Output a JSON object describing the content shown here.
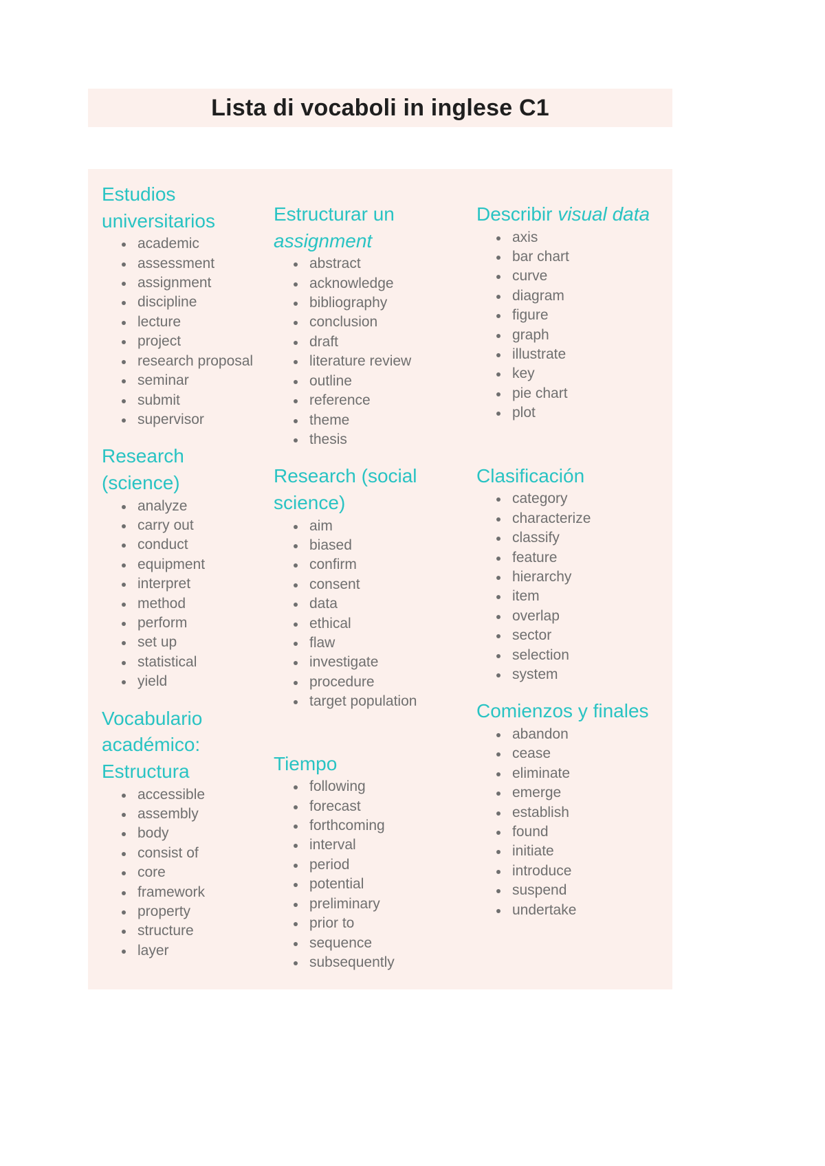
{
  "document": {
    "title": "Lista di vocaboli in inglese C1",
    "accent_color": "#29c3c3",
    "band_color": "#fcf0ec",
    "text_color": "#6f6f6f",
    "title_color": "#1f1f1f"
  },
  "columns": [
    {
      "id": "column-1",
      "sections": [
        {
          "heading_parts": [
            {
              "text": "Estudios universitarios",
              "italic": false
            }
          ],
          "heading_plain": "Estudios universitarios",
          "items": [
            "academic",
            "assessment",
            "assignment",
            "discipline",
            "lecture",
            "project",
            "research proposal",
            "seminar",
            "submit",
            "supervisor"
          ]
        },
        {
          "heading_parts": [
            {
              "text": "Research (science)",
              "italic": false
            }
          ],
          "heading_plain": "Research (science)",
          "items": [
            "analyze",
            "carry out",
            "conduct",
            "equipment",
            "interpret",
            "method",
            "perform",
            "set up",
            "statistical",
            "yield"
          ]
        },
        {
          "heading_parts": [
            {
              "text": "Vocabulario académico: Estructura",
              "italic": false
            }
          ],
          "heading_plain": "Vocabulario académico: Estructura",
          "items": [
            "accessible",
            "assembly",
            "body",
            "consist of",
            "core",
            "framework",
            "property",
            "structure",
            "layer"
          ]
        }
      ]
    },
    {
      "id": "column-2",
      "sections": [
        {
          "heading_parts": [
            {
              "text": "Estructurar un ",
              "italic": false
            },
            {
              "text": "assignment",
              "italic": true
            }
          ],
          "heading_plain": "Estructurar un assignment",
          "items": [
            "abstract",
            "acknowledge",
            "bibliography",
            "conclusion",
            "draft",
            "literature review",
            "outline",
            "reference",
            "theme",
            "thesis"
          ]
        },
        {
          "heading_parts": [
            {
              "text": "Research (social science)",
              "italic": false
            }
          ],
          "heading_plain": "Research (social science)",
          "items": [
            "aim",
            "biased",
            "confirm",
            "consent",
            "data",
            "ethical",
            "flaw",
            "investigate",
            "procedure",
            "target population"
          ]
        },
        {
          "heading_parts": [
            {
              "text": "Tiempo",
              "italic": false
            }
          ],
          "heading_plain": "Tiempo",
          "items": [
            "following",
            "forecast",
            "forthcoming",
            "interval",
            "period",
            "potential",
            "preliminary",
            "prior to",
            "sequence",
            "subsequently"
          ]
        }
      ]
    },
    {
      "id": "column-3",
      "sections": [
        {
          "heading_parts": [
            {
              "text": "Describir ",
              "italic": false
            },
            {
              "text": "visual data",
              "italic": true
            }
          ],
          "heading_plain": "Describir visual data",
          "items": [
            "axis",
            "bar chart",
            "curve",
            "diagram",
            "figure",
            "graph",
            "illustrate",
            "key",
            "pie chart",
            "plot"
          ]
        },
        {
          "heading_parts": [
            {
              "text": "Clasificación",
              "italic": false
            }
          ],
          "heading_plain": "Clasificación",
          "items": [
            "category",
            "characterize",
            "classify",
            "feature",
            "hierarchy",
            "item",
            "overlap",
            "sector",
            "selection",
            "system"
          ]
        },
        {
          "heading_parts": [
            {
              "text": "Comienzos y finales",
              "italic": false
            }
          ],
          "heading_plain": "Comienzos y finales",
          "items": [
            "abandon",
            "cease",
            "eliminate",
            "emerge",
            "establish",
            "found",
            "initiate",
            "introduce",
            "suspend",
            "undertake"
          ]
        }
      ]
    }
  ]
}
